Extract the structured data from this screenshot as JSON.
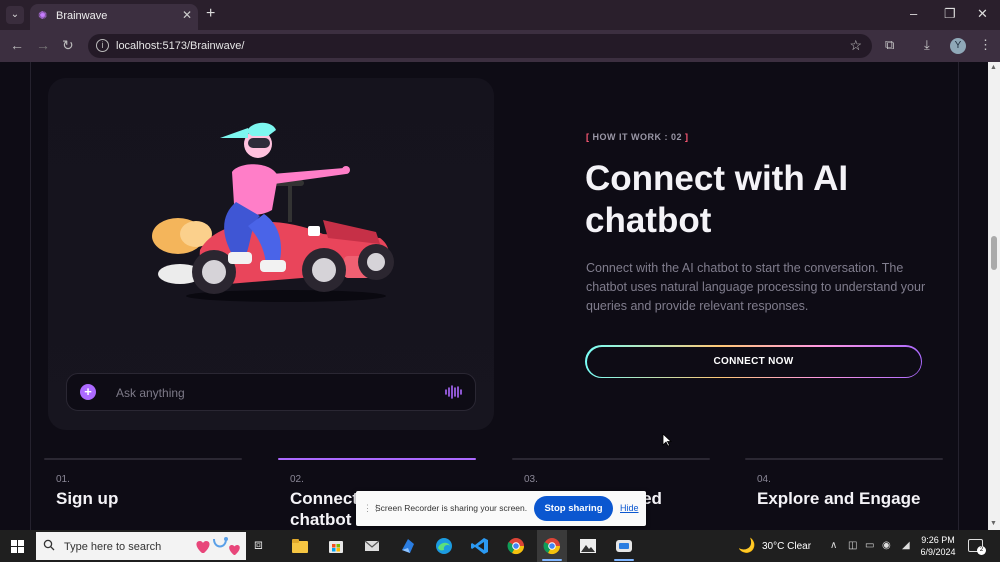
{
  "browser": {
    "tab_title": "Brainwave",
    "url": "localhost:5173/Brainwave/",
    "profile_initial": "Y"
  },
  "card": {
    "ask_placeholder": "Ask anything"
  },
  "hero": {
    "eyebrow_open": "[",
    "eyebrow": " HOW IT WORK : 02 ",
    "eyebrow_close": "]",
    "heading": "Connect with AI chatbot",
    "description": "Connect with the AI chatbot to start the conversation. The chatbot uses natural language processing to understand your queries and provide relevant responses.",
    "cta": "CONNECT NOW"
  },
  "steps": [
    {
      "num": "01.",
      "title": "Sign up",
      "active": false
    },
    {
      "num": "02.",
      "title": "Connect with AI chatbot",
      "active": true
    },
    {
      "num": "03.",
      "title": "Get Personalized Advices",
      "active": false
    },
    {
      "num": "04.",
      "title": "Explore and Engage",
      "active": false
    }
  ],
  "recorder": {
    "message": "Screen Recorder is sharing your screen.",
    "stop": "Stop sharing",
    "hide": "Hide"
  },
  "taskbar": {
    "search_placeholder": "Type here to search",
    "weather": "30°C  Clear",
    "time": "9:26 PM",
    "date": "6/9/2024",
    "notification_count": "2"
  },
  "colors": {
    "accent_purple": "#ac6aff",
    "eyebrow_bracket": "#ff5a76",
    "stop_button": "#0b57d0"
  }
}
